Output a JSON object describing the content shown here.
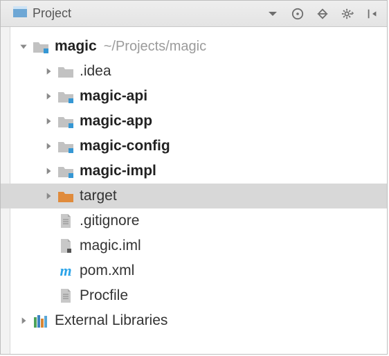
{
  "header": {
    "title": "Project"
  },
  "root": {
    "name": "magic",
    "path": "~/Projects/magic"
  },
  "children": [
    {
      "label": ".idea",
      "bold": false,
      "icon": "folder-plain",
      "expandable": true
    },
    {
      "label": "magic-api",
      "bold": true,
      "icon": "folder-module",
      "expandable": true
    },
    {
      "label": "magic-app",
      "bold": true,
      "icon": "folder-module",
      "expandable": true
    },
    {
      "label": "magic-config",
      "bold": true,
      "icon": "folder-module",
      "expandable": true
    },
    {
      "label": "magic-impl",
      "bold": true,
      "icon": "folder-module",
      "expandable": true
    },
    {
      "label": "target",
      "bold": false,
      "icon": "folder-target",
      "expandable": true,
      "selected": true
    },
    {
      "label": ".gitignore",
      "bold": false,
      "icon": "file-text",
      "expandable": false
    },
    {
      "label": "magic.iml",
      "bold": false,
      "icon": "file-iml",
      "expandable": false
    },
    {
      "label": "pom.xml",
      "bold": false,
      "icon": "maven",
      "expandable": false
    },
    {
      "label": "Procfile",
      "bold": false,
      "icon": "file-text",
      "expandable": false
    }
  ],
  "external": {
    "label": "External Libraries"
  }
}
